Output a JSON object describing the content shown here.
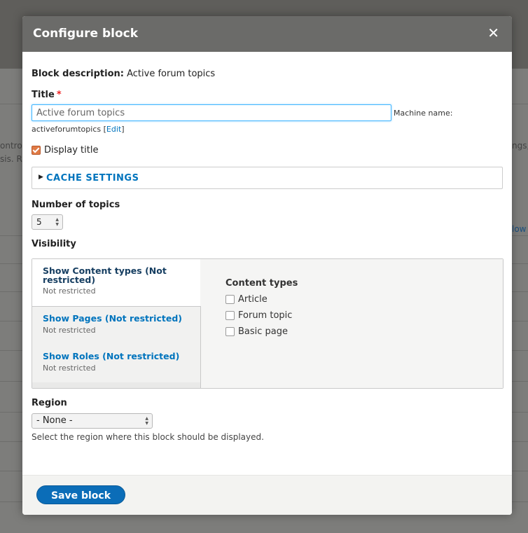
{
  "background": {
    "text_left_1": "ontro",
    "text_left_2": "sis. Re",
    "text_right_1": "ngs,",
    "link_right": "low"
  },
  "dialog": {
    "title": "Configure block",
    "close_icon": "close-icon",
    "close_glyph": "✕"
  },
  "form": {
    "description_label": "Block description:",
    "description_value": "Active forum topics",
    "title_label": "Title",
    "required_marker": "*",
    "title_value": "Active forum topics",
    "machine_name_label": "Machine name:",
    "machine_name_value": "activeforumtopics",
    "machine_edit_open": "[",
    "machine_edit_link": "Edit",
    "machine_edit_close": "]",
    "display_title_label": "Display title",
    "display_title_checked": true,
    "cache_settings_label": "CACHE SETTINGS",
    "number_label": "Number of topics",
    "number_value": "5",
    "visibility_label": "Visibility",
    "region_label": "Region",
    "region_value": "- None -",
    "region_help": "Select the region where this block should be displayed."
  },
  "visibility_tabs": [
    {
      "title": "Show Content types (Not restricted)",
      "title_line1": "Show Content types (Not",
      "title_line2": "restricted)",
      "summary": "Not restricted",
      "active": true
    },
    {
      "title": "Show Pages (Not restricted)",
      "summary": "Not restricted",
      "active": false
    },
    {
      "title": "Show Roles (Not restricted)",
      "summary": "Not restricted",
      "active": false
    }
  ],
  "visibility_pane": {
    "title": "Content types",
    "options": [
      {
        "label": "Article",
        "checked": false
      },
      {
        "label": "Forum topic",
        "checked": false
      },
      {
        "label": "Basic page",
        "checked": false
      }
    ]
  },
  "footer": {
    "save_label": "Save block"
  },
  "colors": {
    "accent": "#0074bd",
    "button": "#0b6db8",
    "titlebar": "#6b6b69",
    "checkbox_checked": "#e07a45"
  }
}
